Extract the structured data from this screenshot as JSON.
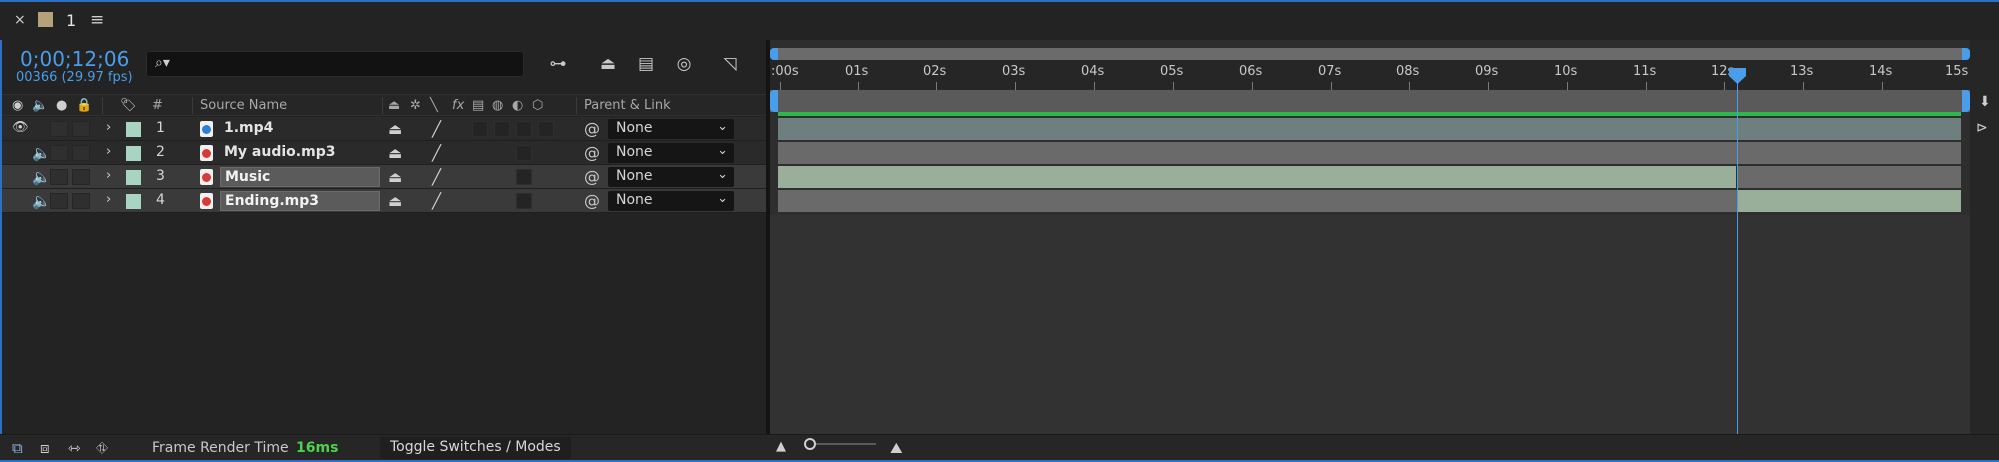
{
  "tab": {
    "close": "×",
    "name": "1",
    "menu": "≡"
  },
  "header": {
    "timecode": "0;00;12;06",
    "fps_info": "00366 (29.97 fps)",
    "search_icon": "⌕▾"
  },
  "columns": {
    "num": "#",
    "source_name": "Source Name",
    "parent_link": "Parent & Link",
    "fx": "fx"
  },
  "layers": [
    {
      "num": "1",
      "name": "1.mp4",
      "parent": "None",
      "type": "video"
    },
    {
      "num": "2",
      "name": "My audio.mp3",
      "parent": "None",
      "type": "audio"
    },
    {
      "num": "3",
      "name": "Music",
      "parent": "None",
      "type": "audio"
    },
    {
      "num": "4",
      "name": "Ending.mp3",
      "parent": "None",
      "type": "audio"
    }
  ],
  "ruler_ticks": [
    ":00s",
    "01s",
    "02s",
    "03s",
    "04s",
    "05s",
    "06s",
    "07s",
    "08s",
    "09s",
    "10s",
    "11s",
    "12s",
    "13s",
    "14s",
    "15s"
  ],
  "footer": {
    "frame_render_label": "Frame Render Time",
    "frame_render_value": "16ms",
    "toggle_label": "Toggle Switches / Modes"
  },
  "colors": {
    "accent": "#4a9de8",
    "label": "#a8d4c2",
    "render_time": "#4ed24e"
  }
}
